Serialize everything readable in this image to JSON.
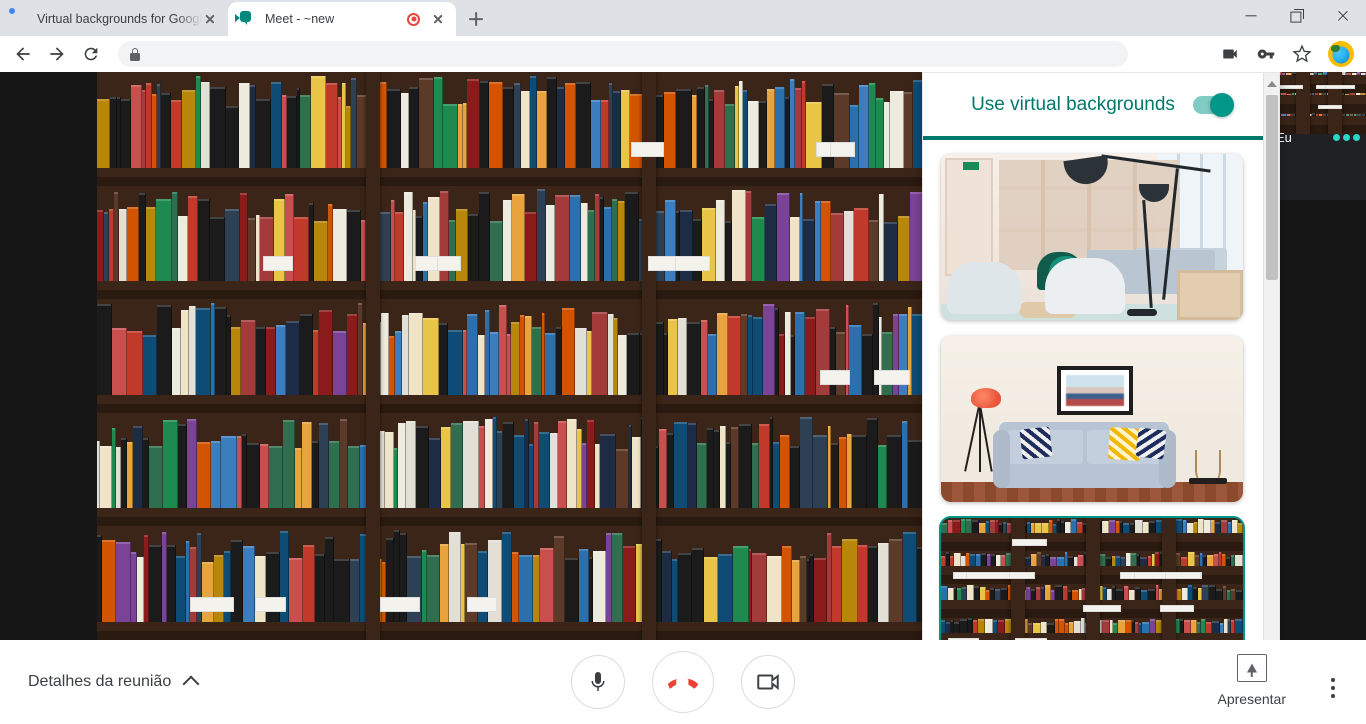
{
  "browser": {
    "tabs": [
      {
        "title": "Virtual backgrounds for Google M",
        "favicon": "chrome-icon",
        "active": false,
        "recording": false
      },
      {
        "title": "Meet - ~new",
        "favicon": "google-meet-icon",
        "active": true,
        "recording": true
      }
    ],
    "new_tab_label": "+",
    "window_controls": {
      "minimize": "–",
      "maximize": "▢",
      "close": "✕"
    },
    "toolbar": {
      "back_icon": "back-arrow-icon",
      "forward_icon": "forward-arrow-icon",
      "reload_icon": "reload-icon",
      "omnibox_value": "",
      "omnibox_placeholder": "",
      "security_icon": "lock-icon",
      "actions": [
        "video-camera-icon",
        "key-icon",
        "bookmark-star-icon"
      ],
      "profile_icon": "profile-avatar"
    }
  },
  "meet": {
    "details_label": "Detalhes da reunião",
    "details_chevron": "chevron-up-icon",
    "controls": [
      {
        "name": "microphone",
        "icon": "microphone-icon",
        "label": ""
      },
      {
        "name": "hangup",
        "icon": "phone-hangup-icon",
        "label": ""
      },
      {
        "name": "camera",
        "icon": "video-camera-icon",
        "label": ""
      }
    ],
    "present_label": "Apresentar",
    "present_icon": "present-screen-icon",
    "more_options_icon": "more-vertical-icon",
    "self_view": {
      "name": "Eu"
    },
    "main_video_alt": "Bookshelf virtual background (mirrored self view)"
  },
  "virtual_backgrounds": {
    "title": "Use virtual backgrounds",
    "toggle_on": true,
    "accent_color": "#00796b",
    "toggle_color": "#009688",
    "selected_index": 2,
    "items": [
      {
        "id": "office-lounge",
        "alt": "Modern office lounge with arc lamps and armchairs",
        "selected": false
      },
      {
        "id": "living-room",
        "alt": "Living room with gray sofa, framed art and red lamp",
        "selected": false
      },
      {
        "id": "bookshelf",
        "alt": "Bookstore shelves filled with colorful books",
        "selected": true
      }
    ],
    "scrollbar": {
      "up_icon": "scroll-up-arrow",
      "down_icon": "scroll-down-arrow"
    }
  }
}
